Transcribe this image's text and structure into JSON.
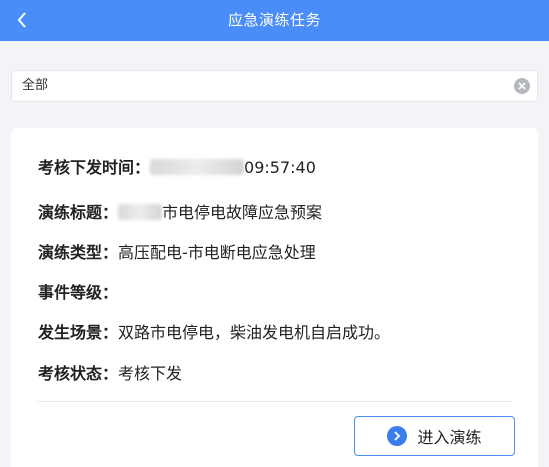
{
  "header": {
    "title": "应急演练任务",
    "back_icon": "chevron-left-icon"
  },
  "filter": {
    "value": "全部",
    "clear_icon": "clear-circle-icon"
  },
  "task": {
    "check_time_label": "考核下发时间：",
    "check_time_value_visible": "09:57:40",
    "title_label": "演练标题：",
    "title_value_visible": "市电停电故障应急预案",
    "type_label": "演练类型：",
    "type_value": "高压配电-市电断电应急处理",
    "level_label": "事件等级：",
    "level_value": "",
    "scene_label": "发生场景：",
    "scene_value": "双路市电停电，柴油发电机自启成功。",
    "status_label": "考核状态：",
    "status_value": "考核下发"
  },
  "actions": {
    "enter_label": "进入演练",
    "enter_icon": "chevron-right-circle-icon"
  },
  "colors": {
    "primary": "#4b8df8",
    "background": "#f2f4f7"
  }
}
